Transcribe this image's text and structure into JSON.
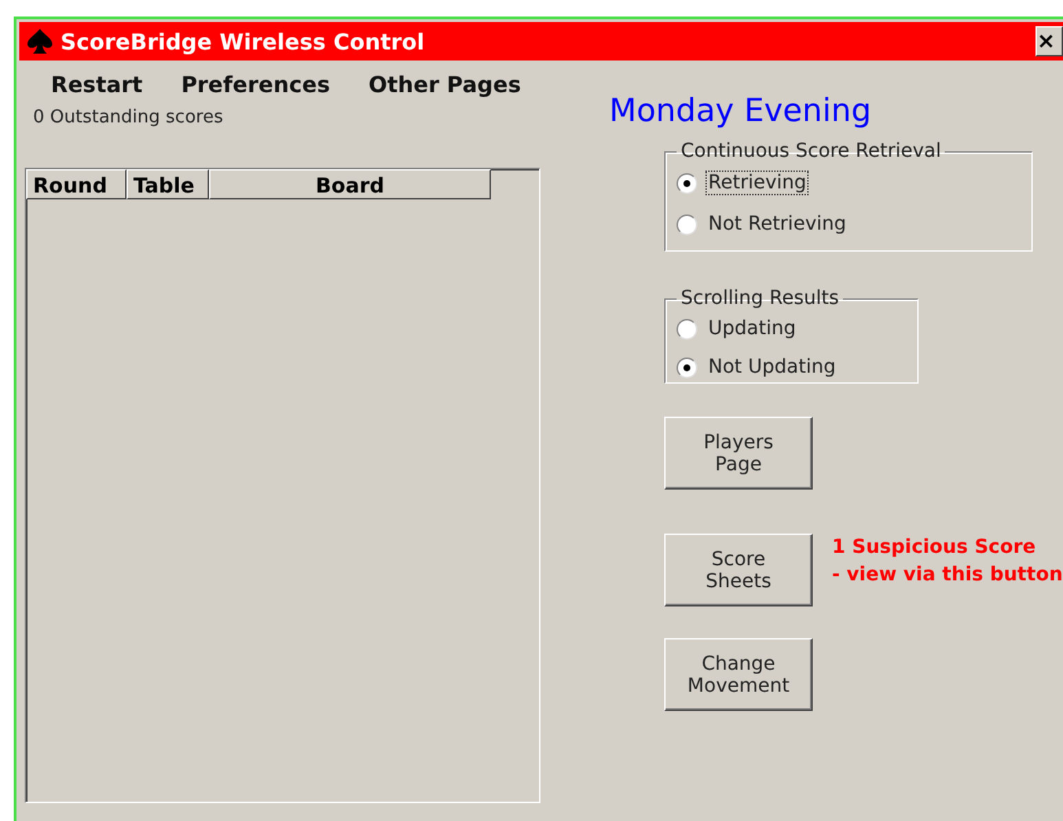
{
  "window": {
    "title": "ScoreBridge Wireless Control",
    "close": "×"
  },
  "menu": [
    "Restart",
    "Preferences",
    "Other Pages"
  ],
  "outstanding": "0 Outstanding scores",
  "session": "Monday Evening",
  "table": {
    "columns": [
      "Round",
      "Table",
      "Board"
    ]
  },
  "groups": [
    {
      "title": "Continuous Score Retrieval",
      "options": [
        {
          "label": "Retrieving",
          "selected": true
        },
        {
          "label": "Not Retrieving",
          "selected": false
        }
      ]
    },
    {
      "title": "Scrolling Results",
      "options": [
        {
          "label": "Updating",
          "selected": false
        },
        {
          "label": "Not Updating",
          "selected": true
        }
      ]
    }
  ],
  "buttons": [
    {
      "lines": [
        "Players",
        "Page"
      ]
    },
    {
      "lines": [
        "Score",
        "Sheets"
      ],
      "note": [
        "1 Suspicious Score",
        "- view via this button"
      ]
    },
    {
      "lines": [
        "Change",
        "Movement"
      ]
    }
  ]
}
